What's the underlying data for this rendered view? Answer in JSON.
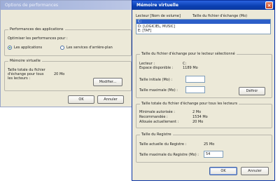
{
  "back_window": {
    "title": "Options de performances",
    "apps_group": {
      "legend": "Performances des applications",
      "prompt": "Optimiser les performances pour :",
      "radio_apps": "Les applications",
      "radio_services": "Les services d'arrière-plan"
    },
    "vm_group": {
      "legend": "Mémoire virtuelle",
      "total_label": "Taille totale du fichier d'échange pour tous les lecteurs :",
      "total_value": "20 Mo",
      "modify_button": "Modifier..."
    },
    "ok_button": "OK",
    "cancel_button": "Annuler"
  },
  "front_window": {
    "title": "Mémoire virtuelle",
    "close_glyph": "×",
    "drive_list": {
      "col_drive": "Lecteur [Nom de volume]",
      "col_size": "Taille du fichier d'échange (Mo)",
      "items": [
        {
          "drive": "C:",
          "size": "",
          "selected": true
        },
        {
          "drive": "D:   [LOGICIEL, MUSIC]",
          "size": "",
          "selected": false
        },
        {
          "drive": "E:   [TAF]",
          "size": "",
          "selected": false
        }
      ]
    },
    "selected_group": {
      "legend": "Taille du fichier d'échange pour le lecteur sélectionné",
      "drive_label": "Lecteur :",
      "drive_value": "C:",
      "space_label": "Espace disponible :",
      "space_value": "1189 Mo",
      "initial_label": "Taille initiale (Mo) :",
      "initial_value": "",
      "max_label": "Taille maximale (Mo) :",
      "max_value": "",
      "set_button": "Définir"
    },
    "total_group": {
      "legend": "Taille totale du fichier d'échange pour tous les lecteurs",
      "min_label": "Minimale autorisée :",
      "min_value": "2 Mo",
      "rec_label": "Recommandée :",
      "rec_value": "1534 Mo",
      "cur_label": "Allouée actuellement :",
      "cur_value": "20 Mo"
    },
    "registry_group": {
      "legend": "Taille du Registre",
      "current_label": "Taille actuelle du Registre :",
      "current_value": "25 Mo",
      "max_label": "Taille maximale du Registre (Mo) :",
      "max_value": "54"
    },
    "ok_button": "OK",
    "cancel_button": "Annuler"
  },
  "colors": {
    "dialog_face": "#ece9d8",
    "active_title": "#0a3fb0",
    "inactive_title": "#8f9fcf",
    "selection": "#2c5ec8"
  }
}
